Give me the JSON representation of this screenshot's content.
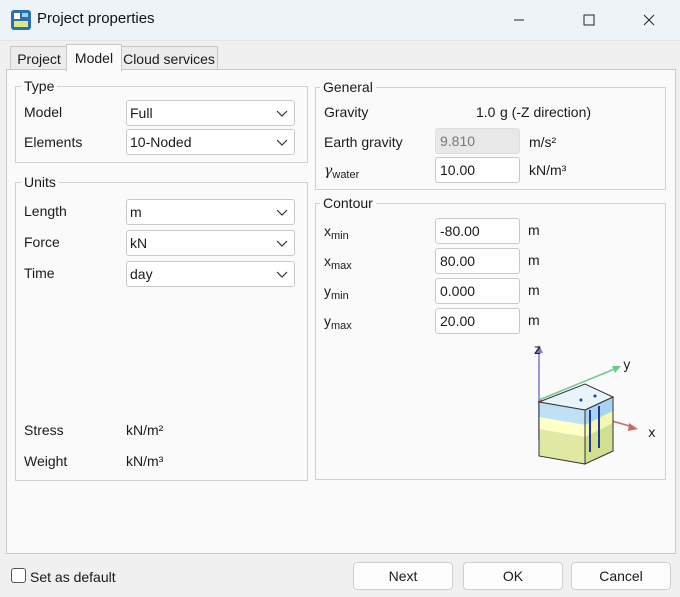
{
  "window": {
    "title": "Project properties"
  },
  "tabs": [
    "Project",
    "Model",
    "Cloud services"
  ],
  "type_group": {
    "title": "Type",
    "model_label": "Model",
    "model_value": "Full",
    "elements_label": "Elements",
    "elements_value": "10-Noded"
  },
  "units_group": {
    "title": "Units",
    "length_label": "Length",
    "length_value": "m",
    "force_label": "Force",
    "force_value": "kN",
    "time_label": "Time",
    "time_value": "day",
    "stress_label": "Stress",
    "stress_value": "kN/m²",
    "weight_label": "Weight",
    "weight_value": "kN/m³"
  },
  "general_group": {
    "title": "General",
    "gravity_label": "Gravity",
    "gravity_value": "1.0",
    "gravity_unit": "g (-Z direction)",
    "earth_gravity_label": "Earth gravity",
    "earth_gravity_value": "9.810",
    "earth_gravity_unit": "m/s²",
    "gamma_symbol": "γ",
    "gamma_sub": "water",
    "gamma_value": "10.00",
    "gamma_unit": "kN/m³"
  },
  "contour_group": {
    "title": "Contour",
    "xmin_sym": "x",
    "xmin_sub": "min",
    "xmin_value": "-80.00",
    "xmin_unit": "m",
    "xmax_sym": "x",
    "xmax_sub": "max",
    "xmax_value": "80.00",
    "xmax_unit": "m",
    "ymin_sym": "y",
    "ymin_sub": "min",
    "ymin_value": "0.000",
    "ymin_unit": "m",
    "ymax_sym": "y",
    "ymax_sub": "max",
    "ymax_value": "20.00",
    "ymax_unit": "m",
    "axis_z": "z",
    "axis_y": "y",
    "axis_x": "x"
  },
  "footer": {
    "set_default_label": "Set as default",
    "next_label": "Next",
    "ok_label": "OK",
    "cancel_label": "Cancel"
  },
  "icons": [
    "app-icon",
    "minimize-icon",
    "maximize-icon",
    "close-icon",
    "chevron-down-icon",
    "model-box-icon"
  ]
}
